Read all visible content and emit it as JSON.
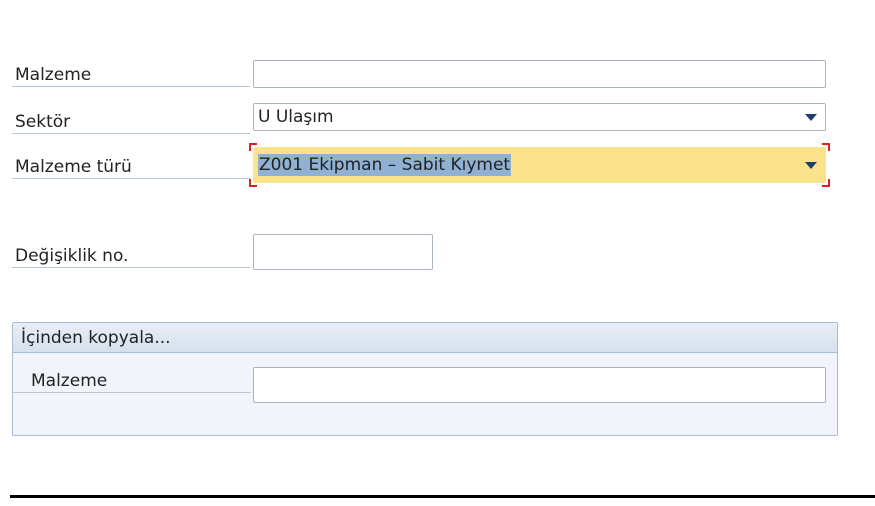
{
  "form": {
    "material": {
      "label": "Malzeme",
      "value": ""
    },
    "sector": {
      "label": "Sektör",
      "value": "U Ulaşım"
    },
    "material_type": {
      "label": "Malzeme türü",
      "value": "Z001 Ekipman – Sabit Kıymet"
    },
    "change_number": {
      "label": "Değişiklik no.",
      "value": ""
    }
  },
  "copy_from": {
    "title": "İçinden kopyala...",
    "material": {
      "label": "Malzeme",
      "value": ""
    }
  }
}
